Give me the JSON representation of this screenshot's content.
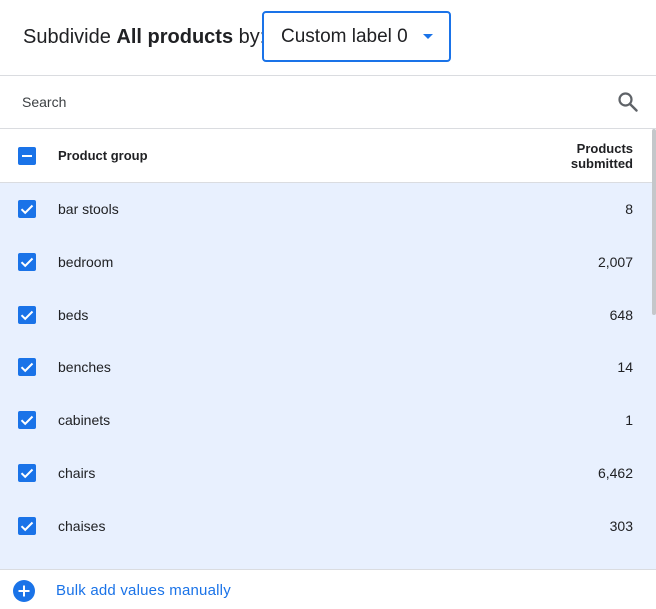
{
  "header": {
    "title_prefix": "Subdivide ",
    "title_bold": "All products",
    "title_suffix": " by:",
    "dropdown_value": "Custom label 0"
  },
  "search": {
    "placeholder": "Search"
  },
  "table": {
    "header_name": "Product group",
    "header_count": "Products submitted",
    "rows": [
      {
        "name": "bar stools",
        "count": "8"
      },
      {
        "name": "bedroom",
        "count": "2,007"
      },
      {
        "name": "beds",
        "count": "648"
      },
      {
        "name": "benches",
        "count": "14"
      },
      {
        "name": "cabinets",
        "count": "1"
      },
      {
        "name": "chairs",
        "count": "6,462"
      },
      {
        "name": "chaises",
        "count": "303"
      }
    ]
  },
  "footer": {
    "bulk_add_label": "Bulk add values manually"
  },
  "colors": {
    "accent": "#1a73e8",
    "selected_row_bg": "#e8f0fe",
    "divider": "#dadce0"
  },
  "icons": {
    "dropdown": "caret-down-icon",
    "search": "search-icon",
    "select_all": "indeterminate-checkbox-icon",
    "row_checkbox": "checkmark-icon",
    "bulk_add": "plus-circle-icon"
  }
}
